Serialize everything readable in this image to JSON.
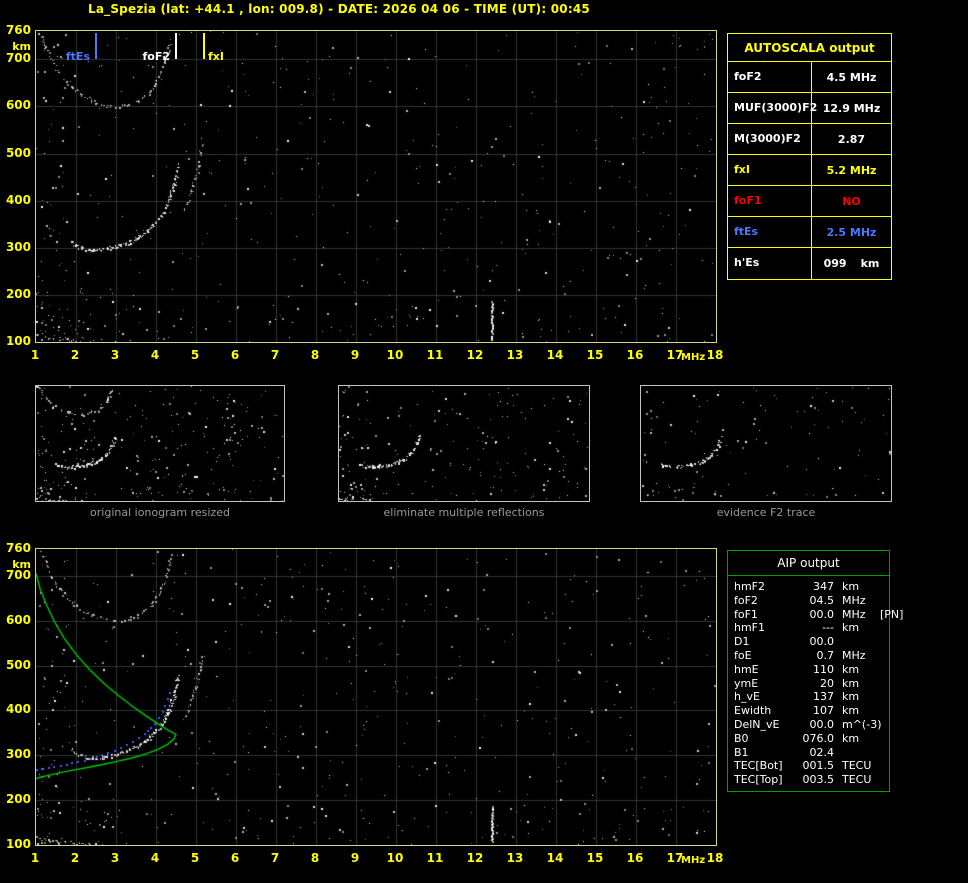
{
  "header": {
    "title": "La_Spezia (lat: +44.1 , lon: 009.8) - DATE: 2026 04 06 - TIME (UT): 00:45"
  },
  "colors": {
    "accent_yellow": "#ffff00",
    "alert_red": "#ff0000",
    "es_blue": "#4a78ff",
    "profile_green": "#00cc00",
    "restored_trace_blue": "#3c5cff",
    "plot_border": "#d8d883",
    "aip_border": "#00a000"
  },
  "autoscala": {
    "header": "AUTOSCALA output",
    "rows": [
      {
        "label": "foF2",
        "value": "4.5 MHz",
        "unit": "",
        "color": "#ffffff"
      },
      {
        "label": "MUF(3000)F2",
        "value": "12.9 MHz",
        "unit": "",
        "color": "#ffffff"
      },
      {
        "label": "M(3000)F2",
        "value": "2.87",
        "unit": "",
        "color": "#ffffff"
      },
      {
        "label": "fxI",
        "value": "5.2 MHz",
        "unit": "",
        "color": "#ffff00"
      },
      {
        "label": "foF1",
        "value": "NO",
        "unit": "",
        "color": "#ff0000"
      },
      {
        "label": "ftEs",
        "value": "2.5 MHz",
        "unit": "",
        "color": "#4a78ff"
      },
      {
        "label": "h'Es",
        "value": "099",
        "unit": "km",
        "color": "#ffffff"
      }
    ]
  },
  "aip": {
    "header": "AIP output",
    "rows": [
      {
        "label": "hmF2",
        "value": "347",
        "unit": "km",
        "note": ""
      },
      {
        "label": "foF2",
        "value": "04.5",
        "unit": "MHz",
        "note": ""
      },
      {
        "label": "foF1",
        "value": "00.0",
        "unit": "MHz",
        "note": "[PN]"
      },
      {
        "label": "hmF1",
        "value": "---",
        "unit": "km",
        "note": ""
      },
      {
        "label": "D1",
        "value": "00.0",
        "unit": "",
        "note": ""
      },
      {
        "label": "foE",
        "value": "0.7",
        "unit": "MHz",
        "note": ""
      },
      {
        "label": "hmE",
        "value": "110",
        "unit": "km",
        "note": ""
      },
      {
        "label": "ymE",
        "value": "20",
        "unit": "km",
        "note": ""
      },
      {
        "label": "h_vE",
        "value": "137",
        "unit": "km",
        "note": ""
      },
      {
        "label": "Ewidth",
        "value": "107",
        "unit": "km",
        "note": ""
      },
      {
        "label": "DelN_vE",
        "value": "00.0",
        "unit": "m^(-3)",
        "note": ""
      },
      {
        "label": "B0",
        "value": "076.0",
        "unit": "km",
        "note": ""
      },
      {
        "label": "B1",
        "value": "02.4",
        "unit": "",
        "note": ""
      },
      {
        "label": "TEC[Bot]",
        "value": "001.5",
        "unit": "TECU",
        "note": ""
      },
      {
        "label": "TEC[Top]",
        "value": "003.5",
        "unit": "TECU",
        "note": ""
      }
    ]
  },
  "chart_data": [
    {
      "id": "ionogram_main",
      "type": "scatter",
      "title": "ionogram with AUTOSCALA markers",
      "xlabel": "MHz",
      "ylabel": "km",
      "xlim": [
        1,
        18
      ],
      "ylim": [
        100,
        760
      ],
      "x_ticks": [
        1,
        2,
        3,
        4,
        5,
        6,
        7,
        8,
        9,
        10,
        11,
        12,
        13,
        14,
        15,
        16,
        17,
        18
      ],
      "y_ticks": [
        760,
        700,
        600,
        500,
        400,
        300,
        200,
        100
      ],
      "grid": true,
      "noise_seed": 11,
      "noise_count": 540,
      "markers": [
        {
          "label": "ftEs",
          "freq_mhz": 2.5,
          "color": "#4a78ff",
          "label_side": "left"
        },
        {
          "label": "foF2",
          "freq_mhz": 4.5,
          "color": "#ffffff",
          "label_side": "left"
        },
        {
          "label": "fxI",
          "freq_mhz": 5.2,
          "color": "#ffff00",
          "label_side": "right"
        }
      ],
      "series": [
        {
          "name": "F2-trace",
          "style": "speckle",
          "color": "#ffffff",
          "density": 2,
          "points": [
            [
              1.9,
              312
            ],
            [
              1.95,
              308
            ],
            [
              2.0,
              304
            ],
            [
              2.1,
              300
            ],
            [
              2.2,
              297
            ],
            [
              2.3,
              295
            ],
            [
              2.45,
              294
            ],
            [
              2.6,
              295
            ],
            [
              2.75,
              297
            ],
            [
              2.9,
              300
            ],
            [
              3.05,
              303
            ],
            [
              3.2,
              307
            ],
            [
              3.35,
              312
            ],
            [
              3.5,
              318
            ],
            [
              3.65,
              326
            ],
            [
              3.8,
              336
            ],
            [
              3.95,
              348
            ],
            [
              4.05,
              358
            ],
            [
              4.15,
              370
            ],
            [
              4.25,
              385
            ],
            [
              4.32,
              400
            ],
            [
              4.38,
              415
            ],
            [
              4.44,
              432
            ],
            [
              4.5,
              452
            ],
            [
              4.54,
              468
            ],
            [
              4.57,
              480
            ]
          ]
        },
        {
          "name": "F2-x-mode-branch",
          "style": "speckle",
          "color": "#c8c8c8",
          "density": 1,
          "points": [
            [
              4.72,
              382
            ],
            [
              4.8,
              398
            ],
            [
              4.88,
              418
            ],
            [
              4.95,
              438
            ],
            [
              5.02,
              460
            ],
            [
              5.07,
              482
            ],
            [
              5.11,
              505
            ],
            [
              5.15,
              525
            ]
          ]
        },
        {
          "name": "F2-second-hop",
          "style": "speckle",
          "color": "#d0d0d0",
          "density": 1,
          "points": [
            [
              1.1,
              755
            ],
            [
              1.18,
              738
            ],
            [
              1.26,
              720
            ],
            [
              1.35,
              703
            ],
            [
              1.45,
              688
            ],
            [
              1.57,
              672
            ],
            [
              1.7,
              658
            ],
            [
              1.85,
              645
            ],
            [
              2.0,
              634
            ],
            [
              2.18,
              623
            ],
            [
              2.36,
              614
            ],
            [
              2.55,
              607
            ],
            [
              2.75,
              602
            ],
            [
              2.95,
              600
            ],
            [
              3.15,
              601
            ],
            [
              3.35,
              605
            ],
            [
              3.55,
              612
            ],
            [
              3.72,
              622
            ],
            [
              3.88,
              635
            ],
            [
              4.02,
              652
            ],
            [
              4.14,
              672
            ],
            [
              4.24,
              695
            ],
            [
              4.32,
              722
            ],
            [
              4.38,
              750
            ]
          ]
        },
        {
          "name": "Es-trace",
          "style": "speckle",
          "color": "#e0e0e0",
          "density": 1,
          "points": [
            [
              1.0,
              115
            ],
            [
              1.15,
              112
            ],
            [
              1.3,
              110
            ],
            [
              1.45,
              108
            ],
            [
              1.6,
              106
            ],
            [
              1.75,
              105
            ],
            [
              1.9,
              104
            ],
            [
              2.05,
              103
            ],
            [
              2.2,
              102
            ],
            [
              2.35,
              101
            ],
            [
              2.5,
              100
            ]
          ]
        },
        {
          "name": "interference-12.4MHz",
          "style": "vline",
          "color": "#ffffff",
          "points": [
            [
              12.4,
              105
            ],
            [
              12.4,
              185
            ]
          ]
        }
      ]
    },
    {
      "id": "thumb_original",
      "type": "scatter",
      "caption": "original ionogram resized",
      "xlim": [
        1,
        12
      ],
      "ylim": [
        100,
        760
      ],
      "grid": false,
      "source_series": [
        "F2-trace",
        "F2-second-hop",
        "Es-trace"
      ],
      "noise_seed": 21,
      "noise_count": 260
    },
    {
      "id": "thumb_cleaned",
      "type": "scatter",
      "caption": "eliminate multiple reflections",
      "xlim": [
        1,
        12
      ],
      "ylim": [
        100,
        760
      ],
      "grid": false,
      "source_series": [
        "F2-trace",
        "Es-trace"
      ],
      "noise_seed": 22,
      "noise_count": 190
    },
    {
      "id": "thumb_f2",
      "type": "scatter",
      "caption": "evidence F2 trace",
      "xlim": [
        1,
        12
      ],
      "ylim": [
        100,
        760
      ],
      "grid": false,
      "source_series": [
        "F2-trace"
      ],
      "noise_seed": 23,
      "noise_count": 120
    },
    {
      "id": "ionogram_profile",
      "type": "scatter",
      "title": "ionogram with restored trace and electron density profile",
      "xlabel": "MHz",
      "ylabel": "km",
      "xlim": [
        1,
        18
      ],
      "ylim": [
        100,
        760
      ],
      "x_ticks": [
        1,
        2,
        3,
        4,
        5,
        6,
        7,
        8,
        9,
        10,
        11,
        12,
        13,
        14,
        15,
        16,
        17,
        18
      ],
      "y_ticks": [
        760,
        700,
        600,
        500,
        400,
        300,
        200,
        100
      ],
      "grid": true,
      "noise_seed": 31,
      "noise_count": 540,
      "source_series": [
        "F2-trace",
        "F2-x-mode-branch",
        "F2-second-hop",
        "Es-trace",
        "interference-12.4MHz"
      ],
      "series": [
        {
          "name": "electron-density-profile",
          "style": "line",
          "color": "#00cc00",
          "points": [
            [
              1.0,
              705
            ],
            [
              1.1,
              672
            ],
            [
              1.25,
              638
            ],
            [
              1.45,
              600
            ],
            [
              1.7,
              562
            ],
            [
              2.0,
              525
            ],
            [
              2.35,
              490
            ],
            [
              2.7,
              460
            ],
            [
              3.05,
              434
            ],
            [
              3.4,
              410
            ],
            [
              3.75,
              388
            ],
            [
              4.05,
              370
            ],
            [
              4.3,
              356
            ],
            [
              4.45,
              349
            ],
            [
              4.5,
              347
            ],
            [
              4.45,
              337
            ],
            [
              4.3,
              325
            ],
            [
              4.05,
              313
            ],
            [
              3.75,
              303
            ],
            [
              3.4,
              294
            ],
            [
              3.05,
              287
            ],
            [
              2.7,
              280
            ],
            [
              2.35,
              274
            ],
            [
              2.0,
              268
            ],
            [
              1.7,
              263
            ],
            [
              1.45,
              258
            ],
            [
              1.25,
              254
            ],
            [
              1.1,
              251
            ],
            [
              1.0,
              248
            ]
          ]
        },
        {
          "name": "restored-trace",
          "style": "dots",
          "color": "#3c5cff",
          "points": [
            [
              1.0,
              268
            ],
            [
              1.15,
              270
            ],
            [
              1.3,
              272
            ],
            [
              1.45,
              274
            ],
            [
              1.6,
              277
            ],
            [
              1.75,
              280
            ],
            [
              1.9,
              283
            ],
            [
              2.05,
              286
            ],
            [
              2.2,
              289
            ],
            [
              2.35,
              293
            ],
            [
              2.5,
              297
            ],
            [
              2.65,
              301
            ],
            [
              2.8,
              306
            ],
            [
              2.95,
              311
            ],
            [
              3.1,
              317
            ],
            [
              3.25,
              323
            ],
            [
              3.4,
              331
            ],
            [
              3.55,
              339
            ],
            [
              3.7,
              349
            ],
            [
              3.85,
              361
            ],
            [
              3.95,
              372
            ],
            [
              4.05,
              384
            ],
            [
              4.15,
              398
            ],
            [
              4.22,
              412
            ],
            [
              4.28,
              426
            ],
            [
              4.34,
              440
            ]
          ]
        }
      ]
    }
  ]
}
